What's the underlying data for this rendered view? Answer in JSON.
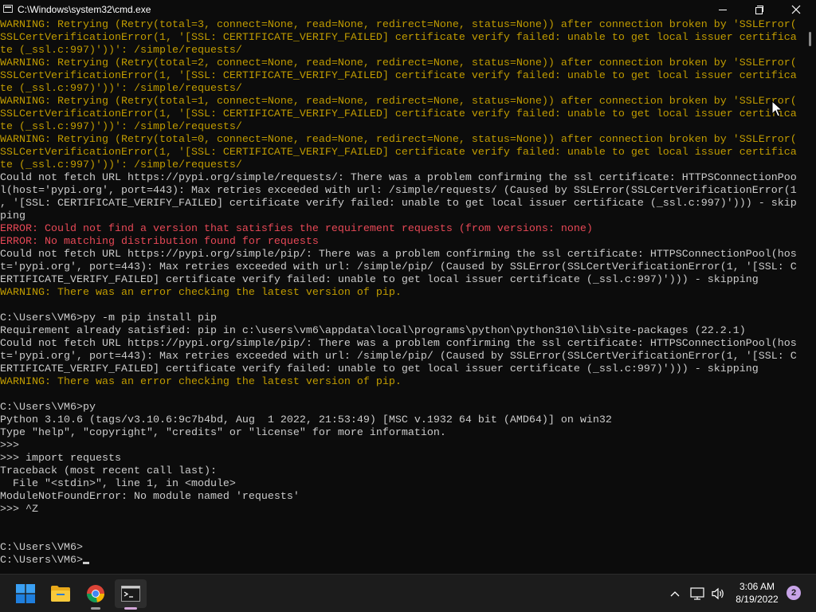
{
  "window": {
    "title": "C:\\Windows\\system32\\cmd.exe"
  },
  "console": {
    "lines": [
      {
        "text": "WARNING: Retrying (Retry(total=3, connect=None, read=None, redirect=None, status=None)) after connection broken by 'SSLError(",
        "style": "warning"
      },
      {
        "text": "SSLCertVerificationError(1, '[SSL: CERTIFICATE_VERIFY_FAILED] certificate verify failed: unable to get local issuer certifica",
        "style": "warning"
      },
      {
        "text": "te (_ssl.c:997)'))': /simple/requests/",
        "style": "warning"
      },
      {
        "text": "WARNING: Retrying (Retry(total=2, connect=None, read=None, redirect=None, status=None)) after connection broken by 'SSLError(",
        "style": "warning"
      },
      {
        "text": "SSLCertVerificationError(1, '[SSL: CERTIFICATE_VERIFY_FAILED] certificate verify failed: unable to get local issuer certifica",
        "style": "warning"
      },
      {
        "text": "te (_ssl.c:997)'))': /simple/requests/",
        "style": "warning"
      },
      {
        "text": "WARNING: Retrying (Retry(total=1, connect=None, read=None, redirect=None, status=None)) after connection broken by 'SSLError(",
        "style": "warning"
      },
      {
        "text": "SSLCertVerificationError(1, '[SSL: CERTIFICATE_VERIFY_FAILED] certificate verify failed: unable to get local issuer certifica",
        "style": "warning"
      },
      {
        "text": "te (_ssl.c:997)'))': /simple/requests/",
        "style": "warning"
      },
      {
        "text": "WARNING: Retrying (Retry(total=0, connect=None, read=None, redirect=None, status=None)) after connection broken by 'SSLError(",
        "style": "warning"
      },
      {
        "text": "SSLCertVerificationError(1, '[SSL: CERTIFICATE_VERIFY_FAILED] certificate verify failed: unable to get local issuer certifica",
        "style": "warning"
      },
      {
        "text": "te (_ssl.c:997)'))': /simple/requests/",
        "style": "warning"
      },
      {
        "text": "Could not fetch URL https://pypi.org/simple/requests/: There was a problem confirming the ssl certificate: HTTPSConnectionPoo",
        "style": "default"
      },
      {
        "text": "l(host='pypi.org', port=443): Max retries exceeded with url: /simple/requests/ (Caused by SSLError(SSLCertVerificationError(1",
        "style": "default"
      },
      {
        "text": ", '[SSL: CERTIFICATE_VERIFY_FAILED] certificate verify failed: unable to get local issuer certificate (_ssl.c:997)'))) - skip",
        "style": "default"
      },
      {
        "text": "ping",
        "style": "default"
      },
      {
        "text": "ERROR: Could not find a version that satisfies the requirement requests (from versions: none)",
        "style": "error"
      },
      {
        "text": "ERROR: No matching distribution found for requests",
        "style": "error"
      },
      {
        "text": "Could not fetch URL https://pypi.org/simple/pip/: There was a problem confirming the ssl certificate: HTTPSConnectionPool(hos",
        "style": "default"
      },
      {
        "text": "t='pypi.org', port=443): Max retries exceeded with url: /simple/pip/ (Caused by SSLError(SSLCertVerificationError(1, '[SSL: C",
        "style": "default"
      },
      {
        "text": "ERTIFICATE_VERIFY_FAILED] certificate verify failed: unable to get local issuer certificate (_ssl.c:997)'))) - skipping",
        "style": "default"
      },
      {
        "text": "WARNING: There was an error checking the latest version of pip.",
        "style": "warning"
      },
      {
        "text": "",
        "style": "default"
      },
      {
        "text": "C:\\Users\\VM6>py -m pip install pip",
        "style": "default"
      },
      {
        "text": "Requirement already satisfied: pip in c:\\users\\vm6\\appdata\\local\\programs\\python\\python310\\lib\\site-packages (22.2.1)",
        "style": "default"
      },
      {
        "text": "Could not fetch URL https://pypi.org/simple/pip/: There was a problem confirming the ssl certificate: HTTPSConnectionPool(hos",
        "style": "default"
      },
      {
        "text": "t='pypi.org', port=443): Max retries exceeded with url: /simple/pip/ (Caused by SSLError(SSLCertVerificationError(1, '[SSL: C",
        "style": "default"
      },
      {
        "text": "ERTIFICATE_VERIFY_FAILED] certificate verify failed: unable to get local issuer certificate (_ssl.c:997)'))) - skipping",
        "style": "default"
      },
      {
        "text": "WARNING: There was an error checking the latest version of pip.",
        "style": "warning"
      },
      {
        "text": "",
        "style": "default"
      },
      {
        "text": "C:\\Users\\VM6>py",
        "style": "default"
      },
      {
        "text": "Python 3.10.6 (tags/v3.10.6:9c7b4bd, Aug  1 2022, 21:53:49) [MSC v.1932 64 bit (AMD64)] on win32",
        "style": "default"
      },
      {
        "text": "Type \"help\", \"copyright\", \"credits\" or \"license\" for more information.",
        "style": "default"
      },
      {
        "text": ">>>",
        "style": "default"
      },
      {
        "text": ">>> import requests",
        "style": "default"
      },
      {
        "text": "Traceback (most recent call last):",
        "style": "default"
      },
      {
        "text": "  File \"<stdin>\", line 1, in <module>",
        "style": "default"
      },
      {
        "text": "ModuleNotFoundError: No module named 'requests'",
        "style": "default"
      },
      {
        "text": ">>> ^Z",
        "style": "default"
      },
      {
        "text": "",
        "style": "default"
      },
      {
        "text": "",
        "style": "default"
      },
      {
        "text": "C:\\Users\\VM6>",
        "style": "default"
      }
    ],
    "prompt": "C:\\Users\\VM6>"
  },
  "taskbar": {
    "apps": [
      {
        "name": "start",
        "icon": "windows-logo-icon"
      },
      {
        "name": "file-explorer",
        "icon": "folder-icon"
      },
      {
        "name": "chrome",
        "icon": "chrome-icon"
      },
      {
        "name": "command-prompt",
        "icon": "terminal-icon",
        "active": true
      }
    ],
    "clock": {
      "time": "3:06 AM",
      "date": "8/19/2022"
    },
    "notification_count": "2"
  },
  "colors": {
    "console_bg": "#0c0c0c",
    "default_text": "#cccccc",
    "warning_text": "#c19c00",
    "error_text": "#e74856",
    "taskbar_bg": "#1c1c1c"
  }
}
